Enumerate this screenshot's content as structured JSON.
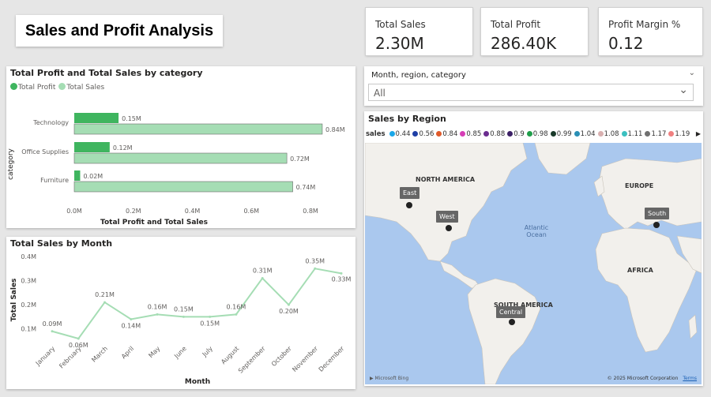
{
  "report": {
    "title": "Sales and Profit Analysis"
  },
  "kpis": [
    {
      "label": "Total Sales",
      "value": "2.30M"
    },
    {
      "label": "Total Profit",
      "value": "286.40K"
    },
    {
      "label": "Profit Margin %",
      "value": "0.12"
    }
  ],
  "bar_visual": {
    "title": "Total Profit and Total Sales by category",
    "legend": [
      "Total Profit",
      "Total Sales"
    ],
    "xlabel": "Total Profit and Total Sales",
    "ylabel": "category",
    "x_ticks": [
      "0.0M",
      "0.2M",
      "0.4M",
      "0.6M",
      "0.8M"
    ]
  },
  "line_visual": {
    "title": "Total Sales by Month",
    "xlabel": "Month",
    "ylabel": "Total Sales",
    "y_ticks": [
      "0.1M",
      "0.2M",
      "0.3M",
      "0.4M"
    ]
  },
  "slicer": {
    "title": "Month, region, category",
    "value": "All"
  },
  "map_visual": {
    "title": "Sales by Region",
    "legend_label": "sales",
    "legend_items": [
      {
        "label": "0.44",
        "color": "#1aa7e8"
      },
      {
        "label": "0.56",
        "color": "#1f3fa6"
      },
      {
        "label": "0.84",
        "color": "#e05a2a"
      },
      {
        "label": "0.85",
        "color": "#d63eb6"
      },
      {
        "label": "0.88",
        "color": "#6b2d8f"
      },
      {
        "label": "0.9",
        "color": "#3c2066"
      },
      {
        "label": "0.98",
        "color": "#1f9e4a"
      },
      {
        "label": "0.99",
        "color": "#1a3a2a"
      },
      {
        "label": "1.04",
        "color": "#2a8fb5"
      },
      {
        "label": "1.08",
        "color": "#d9b0b0"
      },
      {
        "label": "1.11",
        "color": "#3cc0c0"
      },
      {
        "label": "1.17",
        "color": "#707070"
      },
      {
        "label": "1.19",
        "color": "#f08080"
      }
    ],
    "regions": [
      "East",
      "West",
      "South",
      "Central"
    ],
    "place_labels": {
      "north_america": "NORTH AMERICA",
      "europe": "EUROPE",
      "africa": "AFRICA",
      "south_america": "SOUTH AMERICA",
      "ocean": "Atlantic Ocean"
    },
    "attribution": "© 2025 Microsoft Corporation",
    "terms": "Terms",
    "provider": "Microsoft Bing"
  },
  "chart_data": [
    {
      "type": "bar",
      "title": "Total Profit and Total Sales by category",
      "categories": [
        "Technology",
        "Office Supplies",
        "Furniture"
      ],
      "series": [
        {
          "name": "Total Profit",
          "values": [
            0.15,
            0.12,
            0.02
          ],
          "labels": [
            "0.15M",
            "0.12M",
            "0.02M"
          ],
          "color": "#3fb55f"
        },
        {
          "name": "Total Sales",
          "values": [
            0.84,
            0.72,
            0.74
          ],
          "labels": [
            "0.84M",
            "0.72M",
            "0.74M"
          ],
          "color": "#a5ddb4"
        }
      ],
      "xlabel": "Total Profit and Total Sales",
      "ylabel": "category",
      "xlim": [
        0,
        0.8
      ],
      "legend": "top-left"
    },
    {
      "type": "line",
      "title": "Total Sales by Month",
      "categories": [
        "January",
        "February",
        "March",
        "April",
        "May",
        "June",
        "July",
        "August",
        "September",
        "October",
        "November",
        "December"
      ],
      "series": [
        {
          "name": "Total Sales",
          "values": [
            0.09,
            0.06,
            0.21,
            0.14,
            0.16,
            0.15,
            0.15,
            0.16,
            0.31,
            0.2,
            0.35,
            0.33
          ],
          "labels": [
            "0.09M",
            "0.06M",
            "0.21M",
            "0.14M",
            "0.16M",
            "0.15M",
            "0.15M",
            "0.16M",
            "0.31M",
            "0.20M",
            "0.35M",
            "0.33M"
          ],
          "color": "#a5ddb4"
        }
      ],
      "xlabel": "Month",
      "ylabel": "Total Sales",
      "ylim": [
        0.1,
        0.4
      ]
    }
  ]
}
